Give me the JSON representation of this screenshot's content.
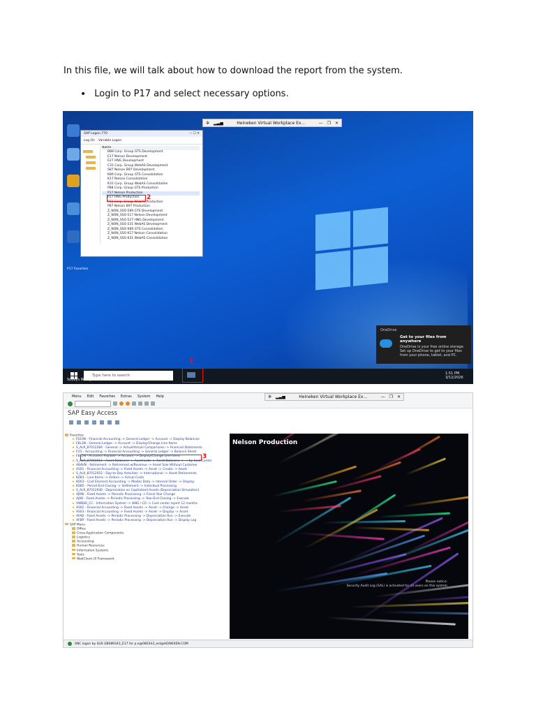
{
  "intro_text": "In this file, we will talk about how to download the report from the system.",
  "bullet_text": "Login to P17 and select necessary options.",
  "screenshot1": {
    "vw_title": "Heineken Virtual Workplace Ex...",
    "logon_title": "SAP Logon 770",
    "logon_menu": [
      "Log On",
      "Variable Logon"
    ],
    "list_header": "Name",
    "systems": [
      "B88 Corp. Group GTS Development",
      "E17 Nelson Development",
      "E27 HNG Development",
      "C31 Corp. Group WebAS Development",
      "S87 Nelson B97 Development",
      "K89 Corp. Group GTS Consolidation",
      "K17 Nelson Consolidation",
      "K31 Corp. Group WebAS Consolidation",
      "P88 Corp. Group GTS Production",
      "P17 Nelson Production",
      "P27 HNG Production",
      "P31 Corp. Group WebAS Production",
      "P87 Nelson B97 Production",
      "Z_NON_SSO E89 GTS Development",
      "Z_NON_SSO E17 Nelson Development",
      "Z_NON_SSO E27 HNG Development",
      "Z_NON_SSO E31 WebAS Development",
      "Z_NON_SSO K89 GTS Consolidation",
      "Z_NON_SSO K17 Nelson Consolidation",
      "Z_NON_SSO K31 WebAS Consolidation"
    ],
    "selected_index": 9,
    "marker2": "2",
    "marker1": "1",
    "toast_title": "Get to your files from anywhere",
    "toast_app": "OneDrive",
    "toast_body": "OneDrive is your free online storage. Set up OneDrive to get to your files from your phone, tablet, and PC.",
    "search_placeholder": "Type here to search",
    "clock_time": "1:51 PM",
    "clock_date": "3/12/2026",
    "user_label": "Sobeys Workplace",
    "desktop_caption": "P17 Favorites"
  },
  "screenshot2": {
    "vw_title": "Heineken Virtual Workplace Ex...",
    "menus": [
      "Menu",
      "Edit",
      "Favorites",
      "Extras",
      "System",
      "Help"
    ],
    "easy_access": "SAP Easy Access",
    "favorites_label": "Favorites",
    "favorites": [
      "FS10N - Financial Accounting -> General Ledger -> Account -> Display Balances",
      "FBL3N - General Ledger -> Account -> Display/Change Line Items",
      "S_ALR_87012284 - General -> Actual/Actual Comparisons -> Financial Statements",
      "F.01 - Accounting -> Financial Accounting -> General Ledger -> Balance Sheet",
      "FBL5N - Accounts Payable -> Account -> Display/Change Line Items",
      "S_ALR_87013611 - Asset Balances -> Asset Lists -> Asset Balances -> ... by Cost Center",
      "ABAVN - Retirement -> Retirement w/Revenue -> Asset Sale Without Customer",
      "AS01 - Financial Accounting -> Fixed Assets -> Asset -> Create -> Asset",
      "S_ALR_87012052 - Day-to-Day Activities -> International -> Asset Retirements",
      "KOB1 - Line Items -> Orders -> Actual Costs",
      "KO03 - Cost Element Accounting -> Master Data -> Internal Order -> Display",
      "KOB5 - Period-End Closing -> Settlement -> Individual Processing",
      "S_ALR_87012936 - Depreciation on Capitalized Assets (Depreciation Simulation)",
      "AJRW - Fixed Assets -> Periodic Processing -> Fiscal Year Change",
      "AJAB - Fixed Assets -> Periodic Processing -> Year-End Closing -> Execute",
      "VWBSR_CC - Information System -> WBS / CO -> Cost center report 12 months",
      "AS02 - Financial Accounting -> Fixed Assets -> Asset -> Change -> Asset",
      "AS03 - Financial Accounting -> Fixed Assets -> Asset -> Display -> Asset",
      "AFAB - Fixed Assets -> Periodic Processing -> Depreciation Run -> Execute",
      "AFBP - Fixed Assets -> Periodic Processing -> Depreciation Run -> Display Log"
    ],
    "highlight_index": 3,
    "marker3": "3",
    "sap_menu_label": "SAP Menu",
    "sap_menu": [
      "Office",
      "Cross-Application Components",
      "Logistics",
      "Accounting",
      "Human Resources",
      "Information Systems",
      "Tools",
      "WebClient UI Framework"
    ],
    "art_title": "Nelson Production",
    "art_foot1": "Please notice:",
    "art_foot2": "Security Audit Log (SAL) is activated for all users on this system",
    "status_text": "SNC logon by SUS UB089343_E17 for p.e@080343_est@HEINEKEN.COM"
  }
}
